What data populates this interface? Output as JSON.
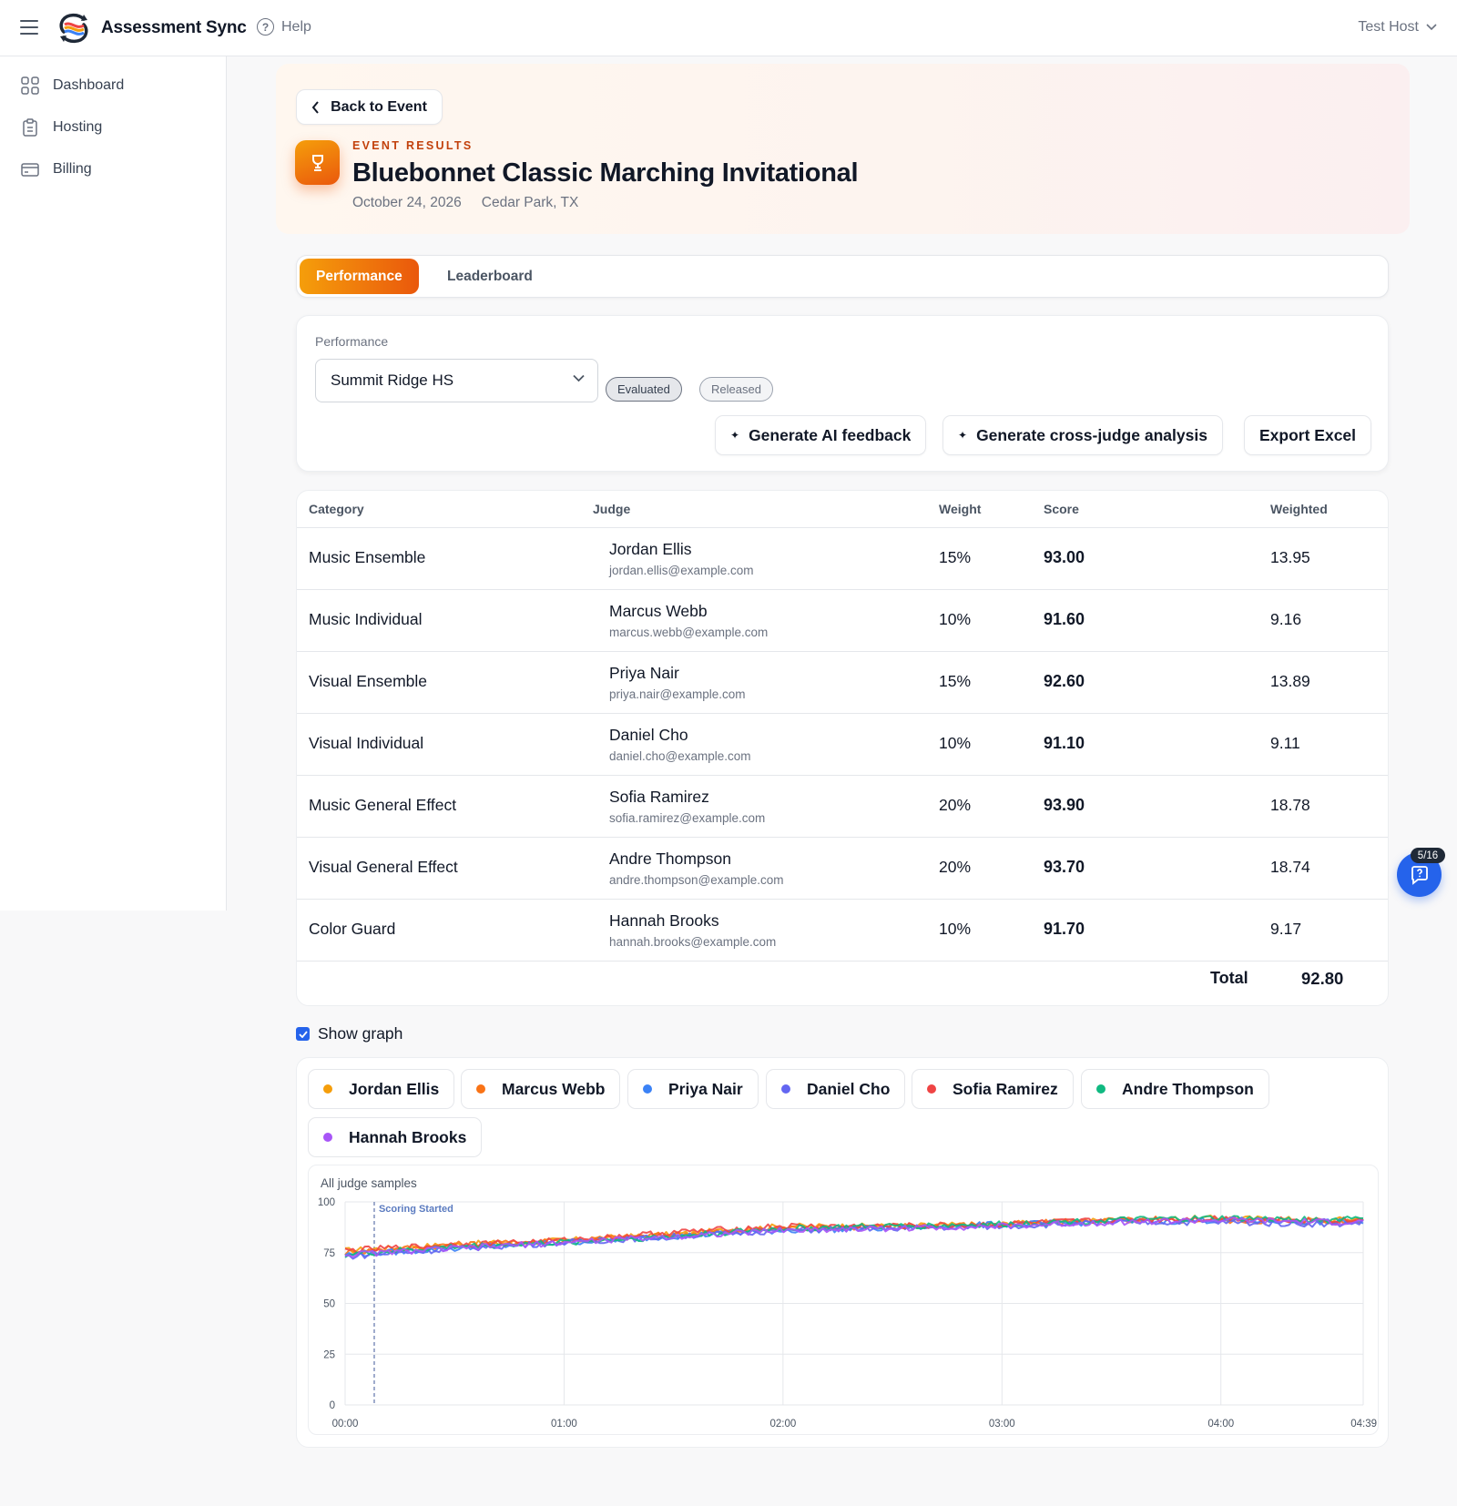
{
  "app": {
    "title": "Assessment Sync",
    "help_label": "Help",
    "user_label": "Test Host"
  },
  "sidebar": {
    "items": [
      {
        "label": "Dashboard",
        "icon": "grid-icon"
      },
      {
        "label": "Hosting",
        "icon": "clipboard-icon"
      },
      {
        "label": "Billing",
        "icon": "card-icon"
      }
    ]
  },
  "event": {
    "back_label": "Back to Event",
    "eyebrow": "EVENT RESULTS",
    "title": "Bluebonnet Classic Marching Invitational",
    "date": "October 24, 2026",
    "location": "Cedar Park, TX"
  },
  "tabs": [
    {
      "label": "Performance",
      "active": true
    },
    {
      "label": "Leaderboard",
      "active": false
    }
  ],
  "performance": {
    "label": "Performance",
    "selected": "Summit Ridge HS",
    "badges": [
      "Evaluated",
      "Released"
    ],
    "actions": [
      "Generate AI feedback",
      "Generate cross-judge analysis",
      "Export Excel"
    ]
  },
  "table": {
    "headers": [
      "Category",
      "Judge",
      "Weight",
      "Score",
      "Weighted"
    ],
    "rows": [
      {
        "category": "Music Ensemble",
        "judge": "Jordan Ellis",
        "email": "jordan.ellis@example.com",
        "weight": "15%",
        "score": "93.00",
        "weighted": "13.95"
      },
      {
        "category": "Music Individual",
        "judge": "Marcus Webb",
        "email": "marcus.webb@example.com",
        "weight": "10%",
        "score": "91.60",
        "weighted": "9.16"
      },
      {
        "category": "Visual Ensemble",
        "judge": "Priya Nair",
        "email": "priya.nair@example.com",
        "weight": "15%",
        "score": "92.60",
        "weighted": "13.89"
      },
      {
        "category": "Visual Individual",
        "judge": "Daniel Cho",
        "email": "daniel.cho@example.com",
        "weight": "10%",
        "score": "91.10",
        "weighted": "9.11"
      },
      {
        "category": "Music General Effect",
        "judge": "Sofia Ramirez",
        "email": "sofia.ramirez@example.com",
        "weight": "20%",
        "score": "93.90",
        "weighted": "18.78"
      },
      {
        "category": "Visual General Effect",
        "judge": "Andre Thompson",
        "email": "andre.thompson@example.com",
        "weight": "20%",
        "score": "93.70",
        "weighted": "18.74"
      },
      {
        "category": "Color Guard",
        "judge": "Hannah Brooks",
        "email": "hannah.brooks@example.com",
        "weight": "10%",
        "score": "91.70",
        "weighted": "9.17"
      }
    ],
    "total_label": "Total",
    "total_value": "92.80"
  },
  "graph": {
    "show_label": "Show graph",
    "checked": true
  },
  "fab": {
    "badge": "5/16"
  },
  "chart_data": {
    "type": "line",
    "title": "All judge samples",
    "annotation": "Scoring Started",
    "annotation_x": 0.133,
    "x_ticks": [
      "00:00",
      "01:00",
      "02:00",
      "03:00",
      "04:00",
      "04:39"
    ],
    "xlim": [
      0,
      4.65
    ],
    "y_ticks": [
      0,
      25,
      50,
      75,
      100
    ],
    "ylim": [
      0,
      100
    ],
    "grid": true,
    "x": [
      0,
      0.5,
      1.0,
      1.5,
      2.0,
      2.5,
      3.0,
      3.5,
      4.0,
      4.5,
      4.65
    ],
    "series": [
      {
        "name": "Jordan Ellis",
        "color": "#f59e0b",
        "values": [
          76,
          79,
          81,
          84,
          88,
          88,
          89,
          91,
          92,
          91,
          92
        ]
      },
      {
        "name": "Marcus Webb",
        "color": "#f97316",
        "values": [
          75,
          79,
          81,
          84,
          87,
          88,
          89,
          91,
          91,
          90,
          91
        ]
      },
      {
        "name": "Priya Nair",
        "color": "#3b82f6",
        "values": [
          74,
          77,
          80,
          83,
          86,
          87,
          89,
          90,
          91,
          90,
          90
        ]
      },
      {
        "name": "Daniel Cho",
        "color": "#6366f1",
        "values": [
          73,
          77,
          80,
          83,
          86,
          87,
          88,
          90,
          90,
          89,
          90
        ]
      },
      {
        "name": "Sofia Ramirez",
        "color": "#ef4444",
        "values": [
          76,
          79,
          81,
          85,
          88,
          88,
          89,
          91,
          92,
          91,
          91
        ]
      },
      {
        "name": "Andre Thompson",
        "color": "#10b981",
        "values": [
          74,
          78,
          80,
          83,
          87,
          88,
          89,
          91,
          92,
          91,
          93
        ]
      },
      {
        "name": "Hannah Brooks",
        "color": "#a855f7",
        "values": [
          74,
          77,
          80,
          83,
          86,
          87,
          88,
          90,
          91,
          90,
          90
        ]
      }
    ]
  }
}
